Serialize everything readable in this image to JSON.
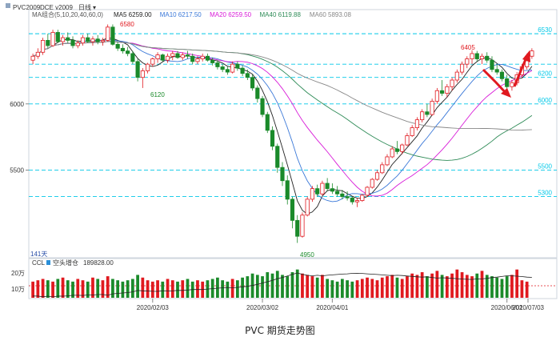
{
  "header": {
    "symbol_code": "PVC2009",
    "exchange_code": "DCE v2009",
    "period": "日线",
    "period_caret": "▾",
    "ma_group_label": "MA组合(5,10,20,40,60,0)",
    "ma_values": [
      {
        "label": "MA5",
        "value": "6259.00",
        "color": "#222222"
      },
      {
        "label": "MA10",
        "value": "6217.50",
        "color": "#3a78d8"
      },
      {
        "label": "MA20",
        "value": "6259.50",
        "color": "#d81ad8"
      },
      {
        "label": "MA40",
        "value": "6119.88",
        "color": "#2e8b57"
      },
      {
        "label": "MA60",
        "value": "5893.08",
        "color": "#888888"
      }
    ]
  },
  "indicator": {
    "name": "CCL",
    "sub_label": "空头增仓",
    "value": "189828.00",
    "y_labels": [
      "20万",
      "10万"
    ]
  },
  "annotations": {
    "high_1": "6580",
    "low_1": "6120",
    "low_2": "4950",
    "high_2": "6405",
    "bars_count": "141天"
  },
  "y_axis_left": [
    "6000",
    "5500"
  ],
  "y_axis_right": [
    "6530",
    "6200",
    "6000",
    "5500",
    "5300"
  ],
  "x_axis": [
    "2020/02/03",
    "2020/03/02",
    "2020/04/01",
    "2020/06/01",
    "2020/07/03"
  ],
  "caption": "PVC 期货走势图",
  "colors": {
    "up": "#e0191f",
    "down": "#1a8a2a",
    "cyan_line": "#00c8e8",
    "arrow": "#e0191f"
  },
  "chart_data": {
    "type": "candlestick",
    "title": "PVC 期货走势图",
    "ylim": [
      4850,
      6700
    ],
    "horizontal_levels": [
      6530,
      6300,
      6200,
      6000,
      5500,
      5300
    ],
    "candles": [
      [
        6330,
        6380,
        6300,
        6360
      ],
      [
        6360,
        6420,
        6340,
        6390
      ],
      [
        6390,
        6500,
        6370,
        6480
      ],
      [
        6480,
        6530,
        6420,
        6440
      ],
      [
        6440,
        6560,
        6430,
        6540
      ],
      [
        6540,
        6560,
        6460,
        6470
      ],
      [
        6470,
        6520,
        6440,
        6500
      ],
      [
        6500,
        6540,
        6460,
        6480
      ],
      [
        6480,
        6510,
        6420,
        6440
      ],
      [
        6440,
        6480,
        6420,
        6460
      ],
      [
        6460,
        6520,
        6440,
        6500
      ],
      [
        6500,
        6530,
        6460,
        6470
      ],
      [
        6470,
        6510,
        6440,
        6490
      ],
      [
        6490,
        6520,
        6450,
        6470
      ],
      [
        6470,
        6500,
        6440,
        6480
      ],
      [
        6480,
        6600,
        6470,
        6580
      ],
      [
        6580,
        6600,
        6440,
        6450
      ],
      [
        6450,
        6470,
        6400,
        6420
      ],
      [
        6420,
        6450,
        6380,
        6400
      ],
      [
        6400,
        6430,
        6360,
        6380
      ],
      [
        6380,
        6400,
        6300,
        6320
      ],
      [
        6320,
        6340,
        6170,
        6200
      ],
      [
        6200,
        6270,
        6120,
        6250
      ],
      [
        6250,
        6310,
        6230,
        6300
      ],
      [
        6300,
        6350,
        6280,
        6340
      ],
      [
        6340,
        6390,
        6310,
        6370
      ],
      [
        6370,
        6380,
        6320,
        6330
      ],
      [
        6330,
        6380,
        6310,
        6360
      ],
      [
        6360,
        6400,
        6330,
        6380
      ],
      [
        6380,
        6400,
        6340,
        6350
      ],
      [
        6350,
        6390,
        6330,
        6370
      ],
      [
        6370,
        6400,
        6340,
        6360
      ],
      [
        6360,
        6380,
        6300,
        6320
      ],
      [
        6320,
        6360,
        6300,
        6340
      ],
      [
        6340,
        6380,
        6320,
        6360
      ],
      [
        6360,
        6380,
        6320,
        6330
      ],
      [
        6330,
        6350,
        6290,
        6310
      ],
      [
        6310,
        6330,
        6260,
        6280
      ],
      [
        6280,
        6300,
        6240,
        6260
      ],
      [
        6260,
        6280,
        6220,
        6240
      ],
      [
        6240,
        6320,
        6230,
        6300
      ],
      [
        6300,
        6320,
        6250,
        6270
      ],
      [
        6270,
        6290,
        6210,
        6230
      ],
      [
        6230,
        6260,
        6180,
        6200
      ],
      [
        6200,
        6220,
        6100,
        6120
      ],
      [
        6120,
        6140,
        6010,
        6040
      ],
      [
        6040,
        6060,
        5900,
        5920
      ],
      [
        5920,
        5940,
        5780,
        5800
      ],
      [
        5800,
        5830,
        5650,
        5680
      ],
      [
        5680,
        5700,
        5480,
        5520
      ],
      [
        5520,
        5560,
        5380,
        5420
      ],
      [
        5420,
        5460,
        5240,
        5280
      ],
      [
        5280,
        5300,
        5060,
        5120
      ],
      [
        5120,
        5160,
        4950,
        5000
      ],
      [
        5000,
        5180,
        4990,
        5160
      ],
      [
        5160,
        5300,
        5150,
        5280
      ],
      [
        5280,
        5380,
        5260,
        5360
      ],
      [
        5360,
        5390,
        5300,
        5320
      ],
      [
        5320,
        5420,
        5310,
        5400
      ],
      [
        5400,
        5440,
        5340,
        5360
      ],
      [
        5360,
        5400,
        5320,
        5340
      ],
      [
        5340,
        5380,
        5300,
        5320
      ],
      [
        5320,
        5350,
        5280,
        5300
      ],
      [
        5300,
        5340,
        5270,
        5290
      ],
      [
        5290,
        5300,
        5240,
        5260
      ],
      [
        5260,
        5290,
        5220,
        5270
      ],
      [
        5270,
        5320,
        5260,
        5310
      ],
      [
        5310,
        5380,
        5300,
        5370
      ],
      [
        5370,
        5440,
        5360,
        5430
      ],
      [
        5430,
        5500,
        5420,
        5480
      ],
      [
        5480,
        5560,
        5470,
        5540
      ],
      [
        5540,
        5620,
        5530,
        5600
      ],
      [
        5600,
        5680,
        5590,
        5660
      ],
      [
        5660,
        5720,
        5620,
        5640
      ],
      [
        5640,
        5700,
        5620,
        5690
      ],
      [
        5690,
        5780,
        5680,
        5760
      ],
      [
        5760,
        5840,
        5750,
        5820
      ],
      [
        5820,
        5900,
        5800,
        5880
      ],
      [
        5880,
        5960,
        5860,
        5940
      ],
      [
        5940,
        6000,
        5900,
        5920
      ],
      [
        5920,
        6040,
        5910,
        6020
      ],
      [
        6020,
        6120,
        6000,
        6100
      ],
      [
        6100,
        6180,
        6060,
        6080
      ],
      [
        6080,
        6150,
        6050,
        6130
      ],
      [
        6130,
        6200,
        6100,
        6180
      ],
      [
        6180,
        6260,
        6160,
        6240
      ],
      [
        6240,
        6320,
        6220,
        6300
      ],
      [
        6300,
        6360,
        6270,
        6340
      ],
      [
        6340,
        6405,
        6300,
        6380
      ],
      [
        6380,
        6400,
        6320,
        6340
      ],
      [
        6340,
        6380,
        6300,
        6360
      ],
      [
        6360,
        6390,
        6310,
        6330
      ],
      [
        6330,
        6360,
        6240,
        6260
      ],
      [
        6260,
        6300,
        6220,
        6240
      ],
      [
        6240,
        6260,
        6170,
        6190
      ],
      [
        6190,
        6220,
        6110,
        6130
      ],
      [
        6130,
        6180,
        6100,
        6160
      ],
      [
        6160,
        6240,
        6140,
        6220
      ],
      [
        6220,
        6300,
        6200,
        6280
      ],
      [
        6280,
        6380,
        6260,
        6360
      ],
      [
        6360,
        6420,
        6340,
        6400
      ]
    ],
    "volume_series": [
      12,
      13,
      14,
      13,
      12,
      14,
      15,
      13,
      12,
      14,
      13,
      12,
      15,
      14,
      13,
      16,
      14,
      13,
      12,
      13,
      14,
      17,
      15,
      13,
      12,
      13,
      12,
      14,
      13,
      12,
      13,
      14,
      12,
      13,
      12,
      13,
      14,
      15,
      13,
      12,
      14,
      13,
      15,
      16,
      18,
      17,
      16,
      19,
      18,
      20,
      17,
      16,
      19,
      21,
      18,
      17,
      16,
      15,
      17,
      14,
      13,
      12,
      14,
      13,
      12,
      13,
      14,
      15,
      14,
      13,
      15,
      16,
      17,
      15,
      14,
      16,
      18,
      17,
      19,
      16,
      18,
      20,
      17,
      16,
      18,
      21,
      19,
      17,
      16,
      18,
      20,
      17,
      16,
      15,
      14,
      16,
      17,
      21,
      13,
      12
    ]
  }
}
